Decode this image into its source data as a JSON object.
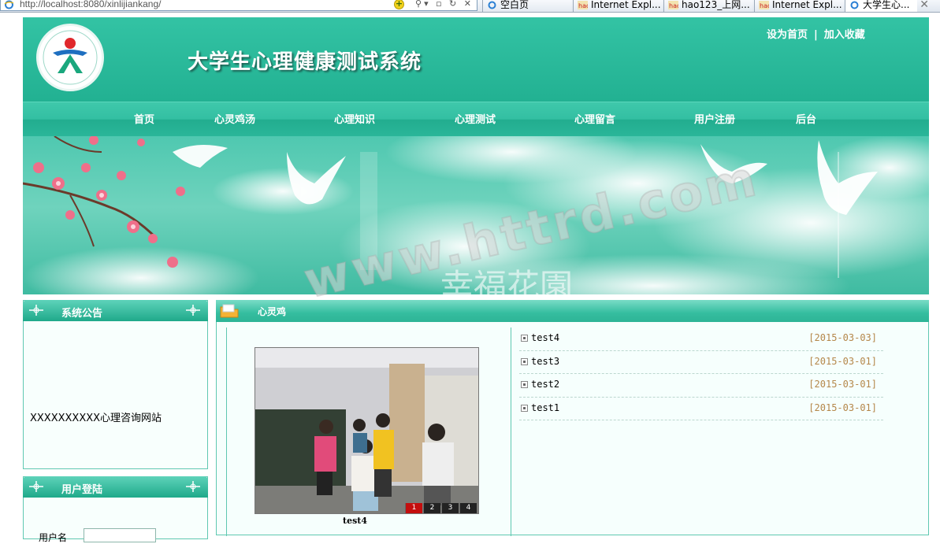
{
  "browser": {
    "url": "http://localhost:8080/xinlijiankang/",
    "tabs": [
      "空白页",
      "Internet Expl...",
      "hao123_上网...",
      "Internet Expl...",
      "大学生心..."
    ]
  },
  "header": {
    "site_title": "大学生心理健康测试系统",
    "links": {
      "set_home": "设为首页",
      "separator": "|",
      "bookmark": "加入收藏"
    }
  },
  "nav": [
    "首页",
    "心灵鸡汤",
    "心理知识",
    "心理测试",
    "心理留言",
    "用户注册",
    "后台"
  ],
  "sidebar": {
    "notice": {
      "title": "系统公告",
      "text": "XXXXXXXXXX心理咨询网站"
    },
    "login": {
      "title": "用户登陆",
      "username_label": "用户名"
    }
  },
  "main": {
    "section_title": "心灵鸡",
    "slideshow": {
      "caption": "test4",
      "slides": [
        "1",
        "2",
        "3",
        "4"
      ],
      "active": "1"
    },
    "articles": [
      {
        "title": "test4",
        "date": "[2015-03-03]"
      },
      {
        "title": "test3",
        "date": "[2015-03-01]"
      },
      {
        "title": "test2",
        "date": "[2015-03-01]"
      },
      {
        "title": "test1",
        "date": "[2015-03-01]"
      }
    ]
  },
  "watermark": "www.httrd.com",
  "colors": {
    "theme_green": "#2ab699",
    "date_color": "#b5874a",
    "active_slide": "#c40e0e"
  }
}
